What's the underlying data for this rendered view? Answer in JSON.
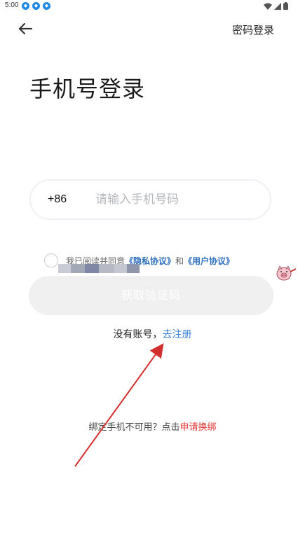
{
  "status_bar": {
    "time": "5:00"
  },
  "header": {
    "back_icon": "arrow-left-icon",
    "password_login": "密码登录"
  },
  "title": "手机号登录",
  "phone": {
    "country_code": "+86",
    "placeholder": "请输入手机号码",
    "value": ""
  },
  "agreement": {
    "prefix": "我已阅读并同意",
    "privacy_link": "《隐私协议》",
    "conjunction": "和",
    "user_link": "《用户协议》",
    "checked": false
  },
  "get_code_button": "获取验证码",
  "register": {
    "text": "没有账号，",
    "link": "去注册"
  },
  "rebind": {
    "text": "绑定手机不可用？点击",
    "link": "申请换绑"
  },
  "colors": {
    "link_blue": "#3a82d8",
    "link_red": "#e53935",
    "annotation_arrow": "#d32f2f",
    "button_disabled": "#f0f0f0"
  }
}
